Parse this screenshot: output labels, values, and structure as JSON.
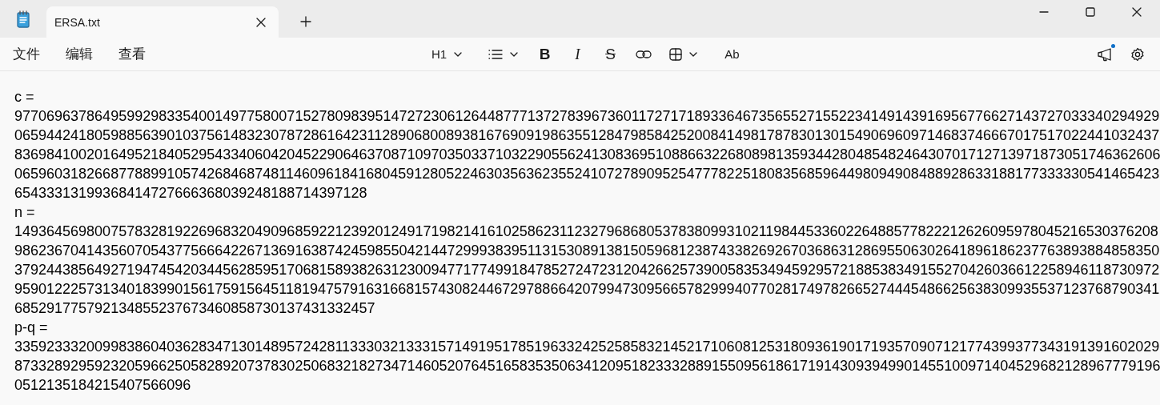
{
  "window": {
    "tab": {
      "title": "ERSA.txt",
      "selected": true
    }
  },
  "menu": [
    "文件",
    "编辑",
    "查看"
  ],
  "toolbar": {
    "heading": "H1",
    "tools": [
      {
        "kind": "list"
      },
      {
        "kind": "bold",
        "glyph": "B"
      },
      {
        "kind": "italic",
        "glyph": "I"
      },
      {
        "kind": "strike",
        "glyph": "S"
      },
      {
        "kind": "link"
      },
      {
        "kind": "table"
      },
      {
        "kind": "spell",
        "glyph": "Ab"
      }
    ]
  },
  "notifications": {
    "unread": true
  },
  "document": {
    "lines": [
      "c =",
      "97706963786495992983354001497758007152780983951472723061264487771372783967360117271718933646735655271552234149143916956776627143727033340294929",
      "06594424180598856390103756148323078728616423112890680089381676909198635512847985842520084149817878301301549069609714683746667017517022441032437",
      "83698410020164952184052954334060420452290646370871097035033710322905562413083695108866322680898135934428048548246430701712713971873051746362606",
      "06596031826687788991057426846874811460961841680459128052246303563623552410727890952547778225180835685964498094908488928633188177333330541465423",
      "65433313199368414727666368039248188714397128",
      "n =",
      "14936456980075783281922696832049096859221239201249171982141610258623112327968680537838099310211984453360226488577822212626095978045216530376208",
      "98623670414356070543775666422671369163874245985504214472999383951131530891381505968123874338269267036863128695506302641896186237763893884858350",
      "37924438564927194745420344562859517068158938263123009477177499184785272472312042662573900583534945929572188538349155270426036612258946118730972",
      "95901222573134018399015617591564511819475791631668157430824467297886642079947309566578299940770281749782665274445486625638309935537123768790341",
      "685291775792134855237673460858730137431332457",
      "p-q =",
      "33592333200998386040362834713014895724281133303213331571491951785196332425258583214521710608125318093619017193570907121774399377343191391602029",
      "87332892959232059662505828920737830250683218273471460520764516583535063412095182333288915509561861719143093949901455100971404529682128967779196",
      "0512135184215407566096"
    ]
  }
}
